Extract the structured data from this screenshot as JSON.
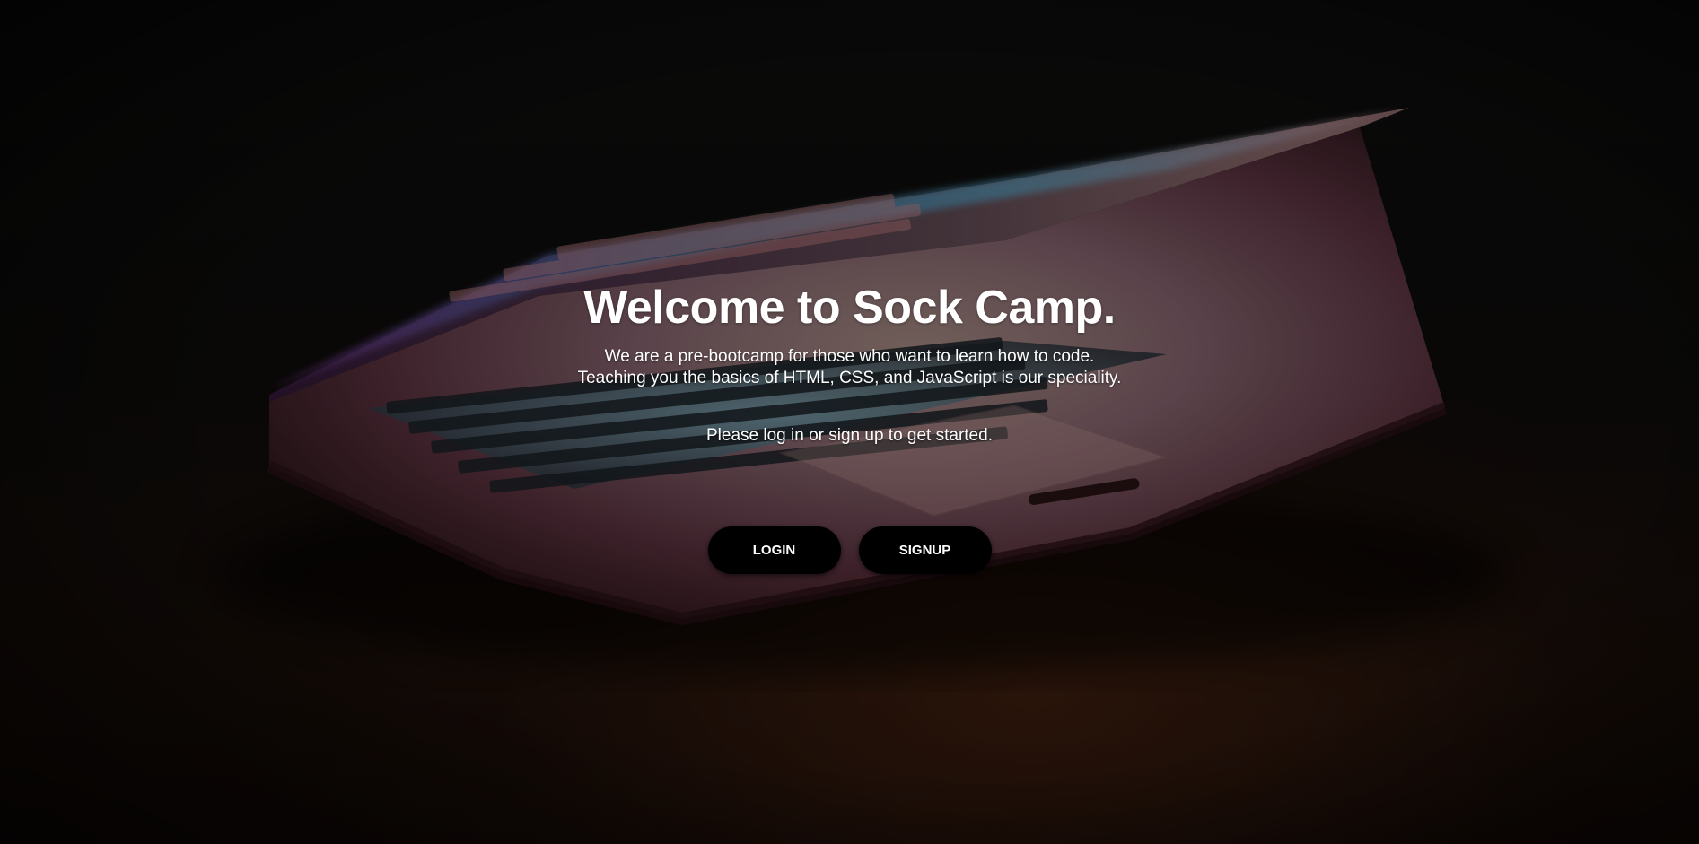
{
  "hero": {
    "title": "Welcome to Sock Camp.",
    "description_line1": "We are a pre-bootcamp for those who want to learn how to code.",
    "description_line2": "Teaching you the basics of HTML, CSS, and JavaScript is our speciality.",
    "call_to_action": "Please log in or sign up to get started."
  },
  "actions": {
    "login_label": "LOGIN",
    "signup_label": "SIGNUP"
  },
  "background": {
    "subject": "laptop-photo",
    "colors": {
      "base": "#0d0d0d",
      "screen_glow_pink": "#d86aa0",
      "screen_glow_blue": "#4fb6d8",
      "wood": "#5a2f18"
    }
  }
}
